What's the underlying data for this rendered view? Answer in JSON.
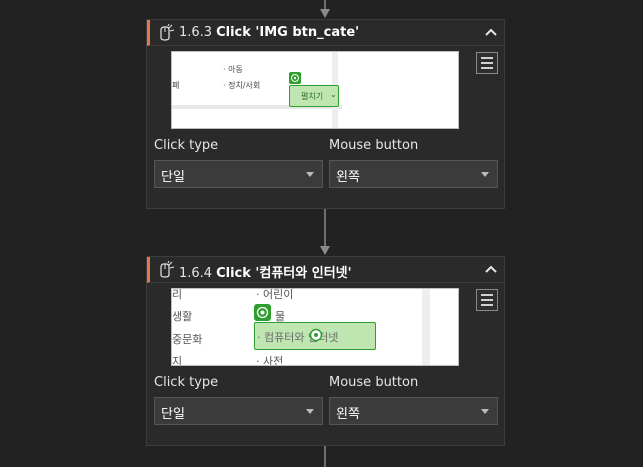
{
  "colors": {
    "accent": "#e07a4a",
    "highlight": "#2e9e2e"
  },
  "steps": [
    {
      "number": "1.6.3",
      "title": "Click 'IMG btn_cate'",
      "preview": {
        "items": [
          "· 아동",
          "· 정치/사회"
        ],
        "left_fragment": "폐",
        "target_label": "펼치기"
      },
      "click_type_label": "Click type",
      "click_type_value": "단일",
      "mouse_button_label": "Mouse button",
      "mouse_button_value": "왼쪽"
    },
    {
      "number": "1.6.4",
      "title": "Click '컴퓨터와 인터넷'",
      "preview": {
        "left_items": [
          "리",
          "생활",
          "중문화",
          "지"
        ],
        "right_items": [
          "· 어린이",
          "· 물",
          "· 사전"
        ],
        "target_label": "· 컴퓨터와 인터넷"
      },
      "click_type_label": "Click type",
      "click_type_value": "단일",
      "mouse_button_label": "Mouse button",
      "mouse_button_value": "왼쪽"
    }
  ]
}
